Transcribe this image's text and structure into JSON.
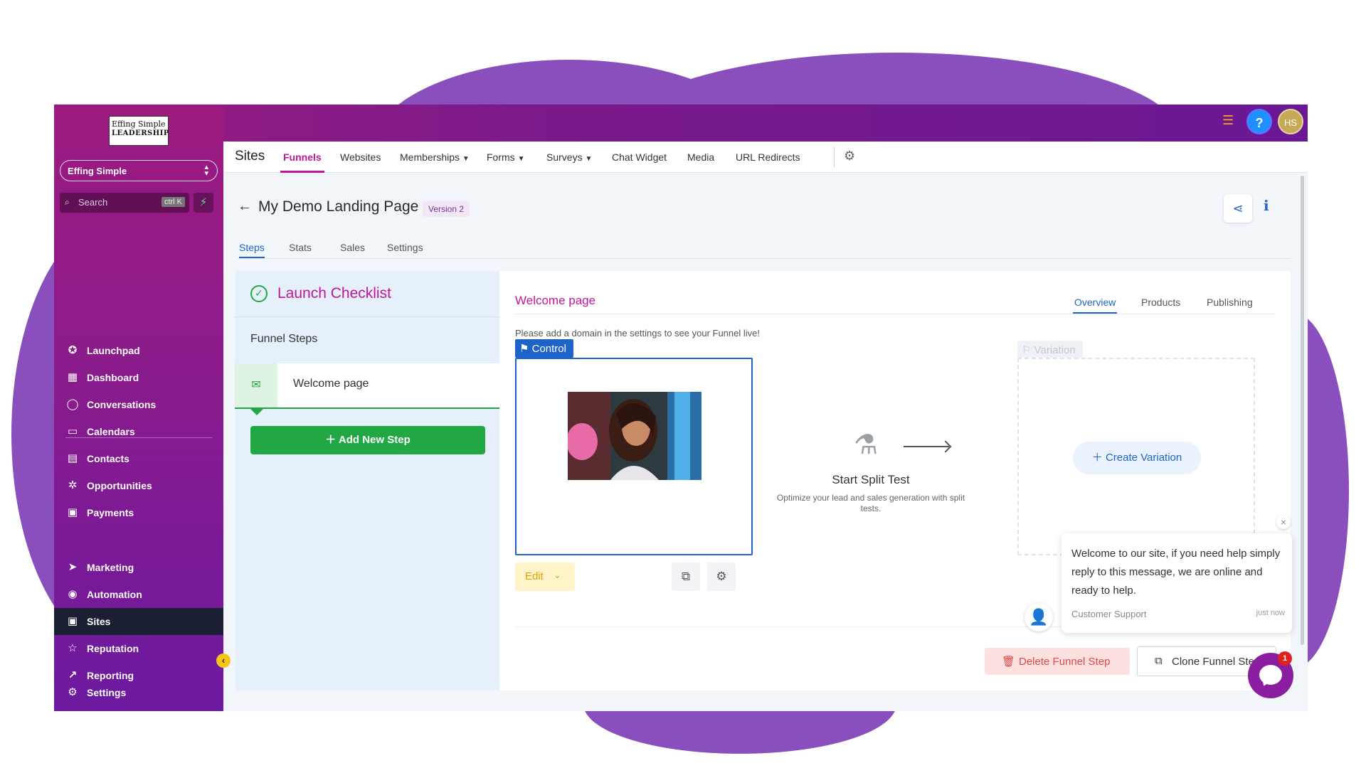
{
  "brand": {
    "logo_line1": "Effing Simple",
    "logo_line2": "LEADERSHIP",
    "account_name": "Effing Simple"
  },
  "search": {
    "placeholder": "Search",
    "shortcut": "ctrl K"
  },
  "sidebar": {
    "items": [
      {
        "label": "Launchpad",
        "icon": "rocket-icon"
      },
      {
        "label": "Dashboard",
        "icon": "grid-icon"
      },
      {
        "label": "Conversations",
        "icon": "chat-icon"
      },
      {
        "label": "Calendars",
        "icon": "calendar-icon"
      },
      {
        "label": "Contacts",
        "icon": "contacts-icon"
      },
      {
        "label": "Opportunities",
        "icon": "opportunities-icon"
      },
      {
        "label": "Payments",
        "icon": "payments-icon"
      },
      {
        "label": "Marketing",
        "icon": "send-icon"
      },
      {
        "label": "Automation",
        "icon": "automation-icon"
      },
      {
        "label": "Sites",
        "icon": "sites-icon",
        "active": true
      },
      {
        "label": "Reputation",
        "icon": "star-icon"
      },
      {
        "label": "Reporting",
        "icon": "trend-icon"
      }
    ],
    "settings_label": "Settings"
  },
  "topbar": {
    "avatar_initials": "HS",
    "help_label": "?"
  },
  "subnav": {
    "title": "Sites",
    "items": [
      "Funnels",
      "Websites",
      "Memberships",
      "Forms",
      "Surveys",
      "Chat Widget",
      "Media",
      "URL Redirects"
    ],
    "active": "Funnels"
  },
  "page": {
    "title": "My Demo Landing Page",
    "version": "Version 2",
    "tabs": [
      "Steps",
      "Stats",
      "Sales",
      "Settings"
    ],
    "active_tab": "Steps"
  },
  "checklist": {
    "title": "Launch Checklist",
    "funnel_steps_label": "Funnel Steps",
    "steps": [
      "Welcome page"
    ],
    "add_step_label": "Add New Step"
  },
  "step_detail": {
    "title": "Welcome page",
    "tabs": [
      "Overview",
      "Products",
      "Publishing"
    ],
    "active_tab": "Overview",
    "domain_message": "Please add a domain in the settings to see your Funnel live!",
    "control_label": "Control",
    "variation_label": "Variation",
    "edit_label": "Edit",
    "split_test_title": "Start Split Test",
    "split_test_subtitle": "Optimize your lead and sales generation with split tests.",
    "create_variation_label": "Create Variation",
    "delete_label": "Delete Funnel Step",
    "clone_label": "Clone Funnel Step"
  },
  "chat": {
    "message": "Welcome to our site, if you need help simply reply to this message, we are online and ready to help.",
    "from": "Customer Support",
    "time": "just now",
    "badge_count": "1"
  },
  "colors": {
    "accent_purple": "#8a4fbd",
    "brand_magenta": "#c0169a",
    "primary_blue": "#1e63c9",
    "success_green": "#22a842"
  }
}
